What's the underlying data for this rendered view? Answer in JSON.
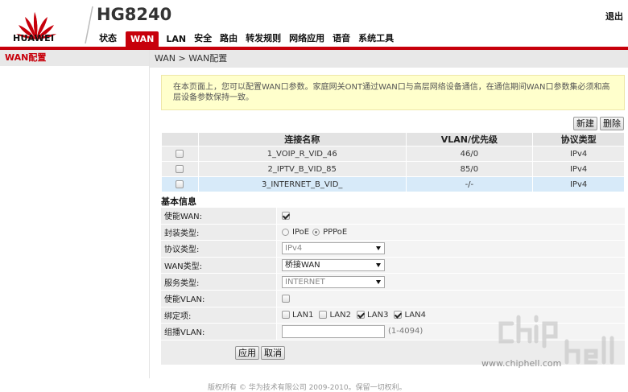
{
  "header": {
    "logo_text": "HUAWEI",
    "model": "HG8240",
    "logout_label": "退出",
    "nav": [
      {
        "label": "状态",
        "active": false
      },
      {
        "label": "WAN",
        "active": true
      },
      {
        "label": "LAN",
        "active": false
      },
      {
        "label": "安全",
        "active": false
      },
      {
        "label": "路由",
        "active": false
      },
      {
        "label": "转发规则",
        "active": false
      },
      {
        "label": "网络应用",
        "active": false
      },
      {
        "label": "语音",
        "active": false
      },
      {
        "label": "系统工具",
        "active": false
      }
    ]
  },
  "sidebar": {
    "items": [
      {
        "label": "WAN配置",
        "active": true
      }
    ]
  },
  "breadcrumb": "WAN > WAN配置",
  "notice": "在本页面上，您可以配置WAN口参数。家庭网关ONT通过WAN口与高层网络设备通信，在通信期间WAN口参数集必须和高层设备参数保持一致。",
  "toolbar": {
    "new_label": "新建",
    "delete_label": "删除"
  },
  "table": {
    "headers": [
      "",
      "连接名称",
      "VLAN/优先级",
      "协议类型"
    ],
    "rows": [
      {
        "name": "1_VOIP_R_VID_46",
        "vlan": "46/0",
        "protocol": "IPv4",
        "selected": false
      },
      {
        "name": "2_IPTV_B_VID_85",
        "vlan": "85/0",
        "protocol": "IPv4",
        "selected": false
      },
      {
        "name": "3_INTERNET_B_VID_",
        "vlan": "-/-",
        "protocol": "IPv4",
        "selected": true
      }
    ]
  },
  "basic": {
    "title": "基本信息",
    "enable_wan": {
      "label": "使能WAN:",
      "checked": true
    },
    "encap": {
      "label": "封装类型:",
      "options": [
        "IPoE",
        "PPPoE"
      ],
      "selected": "PPPoE"
    },
    "protocol": {
      "label": "协议类型:",
      "value": "IPv4"
    },
    "wan_type": {
      "label": "WAN类型:",
      "value": "桥接WAN"
    },
    "service_type": {
      "label": "服务类型:",
      "value": "INTERNET"
    },
    "enable_vlan": {
      "label": "使能VLAN:",
      "checked": false
    },
    "binding": {
      "label": "绑定项:",
      "ports": [
        {
          "name": "LAN1",
          "checked": false
        },
        {
          "name": "LAN2",
          "checked": false
        },
        {
          "name": "LAN3",
          "checked": true
        },
        {
          "name": "LAN4",
          "checked": true
        }
      ]
    },
    "multicast_vlan": {
      "label": "组播VLAN:",
      "value": "",
      "hint": "(1-4094)"
    }
  },
  "actions": {
    "apply_label": "应用",
    "cancel_label": "取消"
  },
  "footer": "版权所有 © 华为技术有限公司 2009-2010。保留一切权利。",
  "watermark": {
    "url": "www.chiphell.com"
  },
  "colors": {
    "brand": "#c7000b",
    "notice_bg": "#ffffcc",
    "selected_row": "#d7eaf9"
  }
}
